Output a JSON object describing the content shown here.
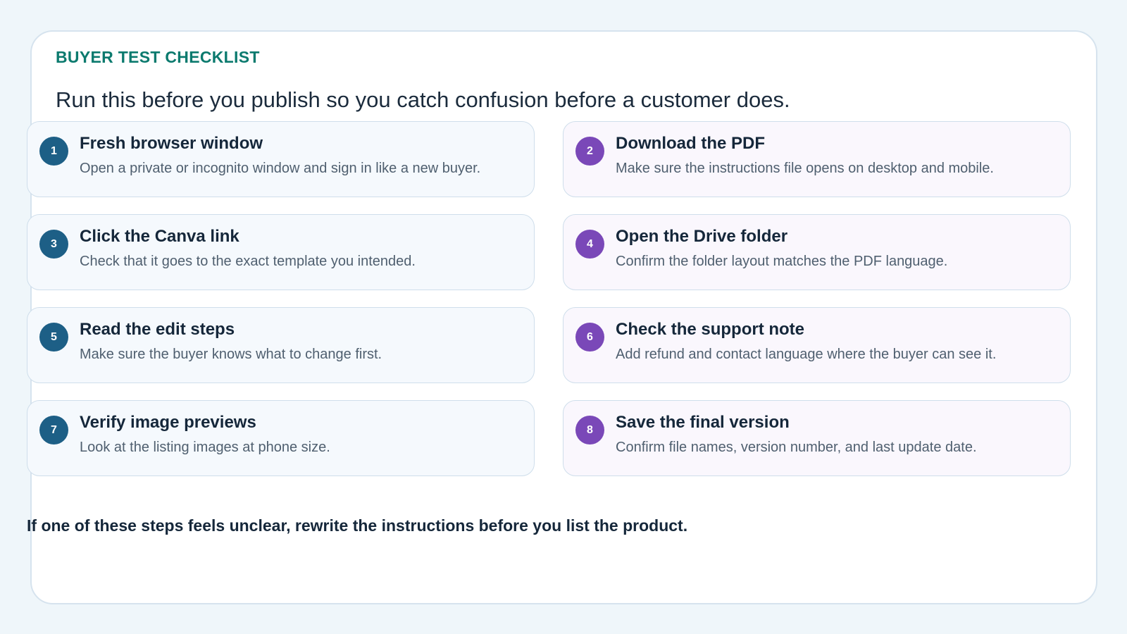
{
  "header": {
    "eyebrow": "BUYER TEST CHECKLIST",
    "subtitle": "Run this before you publish so you catch confusion before a customer does."
  },
  "colors": {
    "eyebrow_teal": "#0b7a6e",
    "badge_blue": "#1d5f86",
    "badge_purple": "#7a48b8"
  },
  "steps": [
    {
      "number": "1",
      "title": "Fresh browser window",
      "description": "Open a private or incognito window and sign in like a new buyer."
    },
    {
      "number": "2",
      "title": "Download the PDF",
      "description": "Make sure the instructions file opens on desktop and mobile."
    },
    {
      "number": "3",
      "title": "Click the Canva link",
      "description": "Check that it goes to the exact template you intended."
    },
    {
      "number": "4",
      "title": "Open the Drive folder",
      "description": "Confirm the folder layout matches the PDF language."
    },
    {
      "number": "5",
      "title": "Read the edit steps",
      "description": "Make sure the buyer knows what to change first."
    },
    {
      "number": "6",
      "title": "Check the support note",
      "description": "Add refund and contact language where the buyer can see it."
    },
    {
      "number": "7",
      "title": "Verify image previews",
      "description": "Look at the listing images at phone size."
    },
    {
      "number": "8",
      "title": "Save the final version",
      "description": "Confirm file names, version number, and last update date."
    }
  ],
  "footer": {
    "note": "If one of these steps feels unclear, rewrite the instructions before you list the product."
  }
}
